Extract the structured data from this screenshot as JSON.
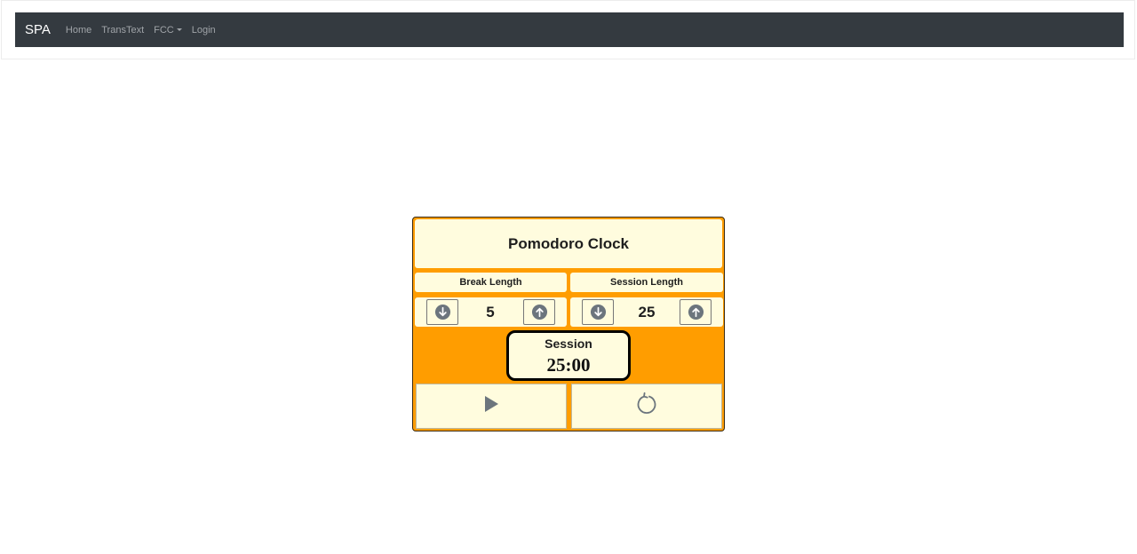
{
  "nav": {
    "brand": "SPA",
    "links": [
      "Home",
      "TransText",
      "FCC",
      "Login"
    ]
  },
  "clock": {
    "title": "Pomodoro Clock",
    "break": {
      "label": "Break Length",
      "value": "5"
    },
    "session": {
      "label": "Session Length",
      "value": "25"
    },
    "timer": {
      "label": "Session",
      "time": "25:00"
    },
    "icons": {
      "decrement": "arrow-down-circle-icon",
      "increment": "arrow-up-circle-icon",
      "play": "play-icon",
      "reset": "reset-icon"
    },
    "colors": {
      "frame": "#ff9d00",
      "panel": "#fffcde",
      "navbar": "#343a40"
    }
  }
}
